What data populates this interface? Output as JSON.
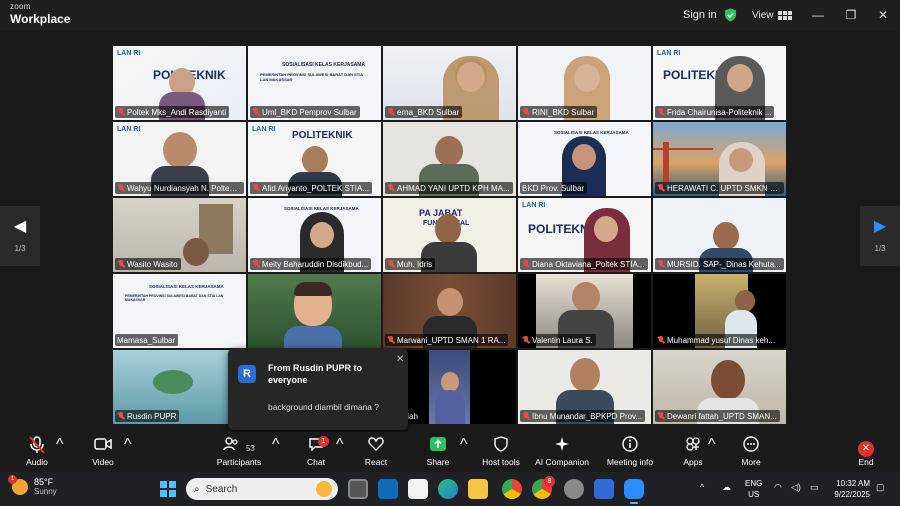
{
  "titlebar": {
    "brand_top": "zoom",
    "brand_bottom": "Workplace",
    "signin_label": "Sign in",
    "view_label": "View",
    "minimize": "—",
    "maximize": "❐",
    "close": "✕"
  },
  "pager": {
    "left_page": "1/3",
    "right_page": "1/3"
  },
  "participants": [
    {
      "name": "Poltek Mks_Andi Rasdiyanti"
    },
    {
      "name": "Uml_BKD Pemprov Sulbar"
    },
    {
      "name": "erna_BKD Sulbar"
    },
    {
      "name": "RINI_BKD Sulbar"
    },
    {
      "name": "Frida Chairunisa-Politeknik ..."
    },
    {
      "name": "Wahyu Nurdiansyah N. Poltek S..."
    },
    {
      "name": "Afid Ariyanto_POLTEK STIA..."
    },
    {
      "name": "AHMAD YANI UPTD KPH MA..."
    },
    {
      "name": "BKD Prov. Sulbar"
    },
    {
      "name": "HERAWATI C. UPTD SMKN C..."
    },
    {
      "name": "Wasito Wasito"
    },
    {
      "name": "Meity Baharuddin Disdikbud..."
    },
    {
      "name": "Muh. Idris"
    },
    {
      "name": "Diana Oktaviana_Poltek STIA..."
    },
    {
      "name": "MURSID. SAP-_Dinas Kehuta..."
    },
    {
      "name": "Mamasa_Sulbar"
    },
    {
      "name": ""
    },
    {
      "name": "Marwani_UPTD SMAN 1 RA..."
    },
    {
      "name": "Valentin Laura S."
    },
    {
      "name": "Muhammad yusuf Dinas keh..."
    },
    {
      "name": "Rusdin PUPR"
    },
    {
      "name": ""
    },
    {
      "name": "ilmiah"
    },
    {
      "name": "Ibnu Munandar_BPKPD Prov..."
    },
    {
      "name": "Dewanri fattah_UPTD SMAN..."
    }
  ],
  "slide": {
    "logo": "LAN RI",
    "title_big": "POLITEKNIK",
    "title_mid": "STIA",
    "title_small": "MAKASSAR",
    "doc_title": "SOSIALISASI KELAS KERJASAMA",
    "doc_sub": "PEMERINTAH PROVINSI SULAWESI BARAT DAN STIA LAN MAKASSAR",
    "jab_title": "FUNGSIONAL",
    "jab_top": "PA JABAT"
  },
  "chat_toast": {
    "avatar": "R",
    "from": "From Rusdin PUPR to everyone",
    "message": "background diambil dimana ?",
    "close": "✕"
  },
  "toolbar": {
    "audio": "Audio",
    "video": "Video",
    "participants": "Participants",
    "participants_count": "53",
    "chat": "Chat",
    "chat_badge": "1",
    "react": "React",
    "share": "Share",
    "host_tools": "Host tools",
    "ai_companion": "AI Companion",
    "meeting_info": "Meeting info",
    "apps": "Apps",
    "more": "More",
    "end": "End"
  },
  "taskbar": {
    "temperature": "85°F",
    "condition": "Sunny",
    "weather_badge": "1",
    "search": "Search",
    "lang1": "ENG",
    "lang2": "US",
    "time": "10:32 AM",
    "date": "9/22/2025",
    "badge_app": "8"
  },
  "colors": {
    "accent_green": "#4ad37a",
    "end_red": "#e0312f",
    "share_green": "#2fbf5f",
    "slide_navy": "#1b2a64",
    "slide_gold": "#c28d1a"
  }
}
